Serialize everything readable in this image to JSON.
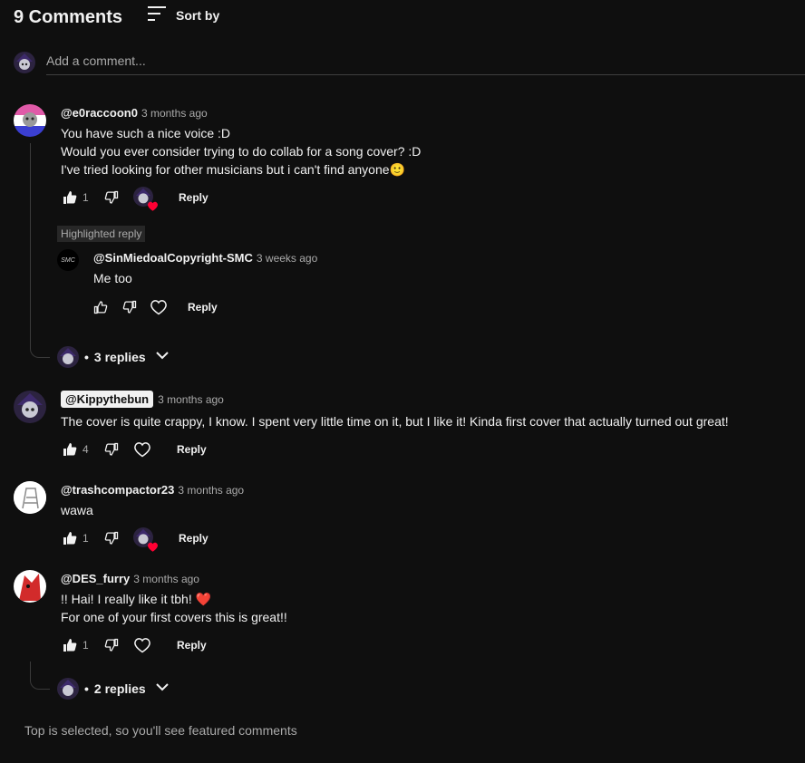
{
  "header": {
    "count_label": "9 Comments",
    "sort_label": "Sort by",
    "sort_icon": "sort-lines-icon"
  },
  "add_comment": {
    "placeholder": "Add a comment..."
  },
  "comments": [
    {
      "author": "@e0raccoon0",
      "time": "3 months ago",
      "lines": [
        "You have such a nice voice :D",
        "Would you ever consider trying to do collab for a song cover? :D",
        "I've tried looking for other musicians but i can't find anyone"
      ],
      "emoji": "🙂",
      "likes": "1",
      "reply_label": "Reply",
      "hearted": true
    },
    {
      "author": "@Kippythebun",
      "time": "3 months ago",
      "lines": [
        "The cover is quite crappy, I know. I spent very little time on it, but I like it! Kinda first cover that actually turned out great!"
      ],
      "likes": "4",
      "reply_label": "Reply",
      "owner": true
    },
    {
      "author": "@trashcompactor23",
      "time": "3 months ago",
      "lines": [
        "wawa"
      ],
      "likes": "1",
      "reply_label": "Reply",
      "hearted": true
    },
    {
      "author": "@DES_furry",
      "time": "3 months ago",
      "lines": [
        "!! Hai! I really like it tbh!",
        "For one of your first covers this is great!!"
      ],
      "emoji": "❤️",
      "likes": "1",
      "reply_label": "Reply"
    }
  ],
  "highlighted_reply": {
    "badge": "Highlighted reply",
    "author": "@SinMiedoalCopyright-SMC",
    "avatar_text": "SMC",
    "time": "3 weeks ago",
    "text": "Me too",
    "reply_label": "Reply"
  },
  "replies_toggles": [
    {
      "label": "3 replies",
      "bullet": "•"
    },
    {
      "label": "2 replies",
      "bullet": "•"
    }
  ],
  "footer_note": "Top is selected, so you'll see featured comments",
  "colors": {
    "background": "#0f0f0f",
    "text": "#f1f1f1",
    "secondary_text": "#aaaaaa",
    "heart": "#ff0033"
  }
}
